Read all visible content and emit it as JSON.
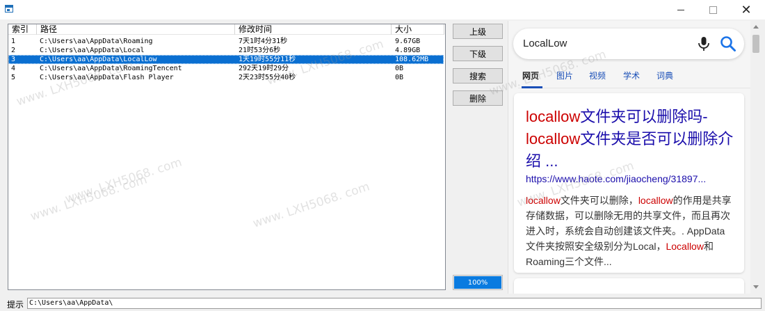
{
  "window": {
    "controls": {
      "minimize_icon": "minimize-icon",
      "maximize_icon": "maximize-icon",
      "close_label": "✕"
    }
  },
  "list": {
    "columns": [
      "索引",
      "路径",
      "修改时间",
      "大小"
    ],
    "rows": [
      {
        "index": "1",
        "path": "C:\\Users\\aa\\AppData\\Roaming",
        "modified": "7天1时4分31秒",
        "size": "9.67GB"
      },
      {
        "index": "2",
        "path": "C:\\Users\\aa\\AppData\\Local",
        "modified": "21时53分6秒",
        "size": "4.89GB"
      },
      {
        "index": "3",
        "path": "C:\\Users\\aa\\AppData\\LocalLow",
        "modified": "1天19时55分11秒",
        "size": "108.62MB",
        "selected": true
      },
      {
        "index": "4",
        "path": "C:\\Users\\aa\\AppData\\RoamingTencent",
        "modified": "292天19时29分",
        "size": "0B"
      },
      {
        "index": "5",
        "path": "C:\\Users\\aa\\AppData\\Flash Player",
        "modified": "2天23时55分40秒",
        "size": "0B"
      }
    ]
  },
  "buttons": {
    "up": "上级",
    "down": "下级",
    "search": "搜索",
    "delete": "删除"
  },
  "progress": {
    "value": 100,
    "label": "100%"
  },
  "browser": {
    "search_query": "LocalLow",
    "tabs": [
      {
        "label": "网页",
        "active": true
      },
      {
        "label": "图片"
      },
      {
        "label": "视频"
      },
      {
        "label": "学术"
      },
      {
        "label": "词典"
      }
    ],
    "result": {
      "title_parts": [
        {
          "text": "locallow",
          "hl": true
        },
        {
          "text": "文件夹可以删除吗-",
          "hl": false
        },
        {
          "text": "locallow",
          "hl": true
        },
        {
          "text": "文件夹是否可以删除介绍 ...",
          "hl": false
        }
      ],
      "url": "https://www.haote.com/jiaocheng/31897...",
      "snippet_parts": [
        {
          "text": "locallow",
          "hl": true
        },
        {
          "text": "文件夹可以删除，",
          "hl": false
        },
        {
          "text": "locallow",
          "hl": true
        },
        {
          "text": "的作用是共享存储数据，可以删除无用的共享文件，而且再次进入时，系统会自动创建该文件夹。. AppData文件夹按照安全级别分为Local，",
          "hl": false
        },
        {
          "text": "Locallow",
          "hl": true
        },
        {
          "text": "和Roaming三个文件...",
          "hl": false
        }
      ]
    },
    "colors": {
      "link": "#1a0dab",
      "highlight": "#cc0000",
      "tab_active": "#1a4fb7"
    }
  },
  "status": {
    "label": "提示",
    "value": "C:\\Users\\aa\\AppData\\"
  },
  "watermark": "www. LXH5068. com"
}
